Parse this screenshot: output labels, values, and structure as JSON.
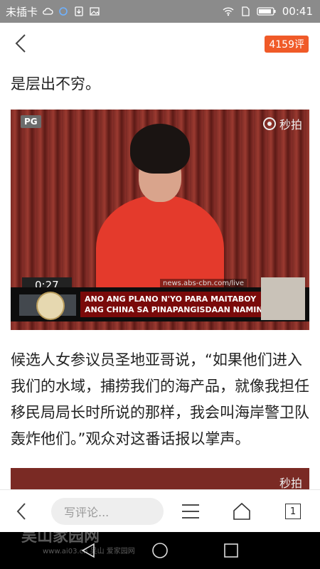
{
  "status_bar": {
    "carrier": "未插卡",
    "time": "00:41",
    "icons": [
      "cloud-icon",
      "sync-icon",
      "download-icon",
      "image-icon",
      "wifi-icon",
      "sim-icon",
      "battery-icon"
    ]
  },
  "header": {
    "comment_count": "4159评"
  },
  "article": {
    "paragraph_tail": "是层出不穷。",
    "video": {
      "rating": "PG",
      "watermark": "秒拍",
      "timestamp": "0:27",
      "source_url": "news.abs-cbn.com/live",
      "caption_line1": "ANO ANG PLANO N'YO PARA MAITABOY",
      "caption_line2": "ANG CHINA SA PINAPANGISDAAN NAMIN?"
    },
    "caption": "候选人女参议员圣地亚哥说，“如果他们进入我们的水域，捕捞我们的海产品，就像我担任移民局局长时所说的那样，我会叫海岸警卫队轰炸他们。”观众对这番话报以掌声。",
    "video2_watermark": "秒拍"
  },
  "bottom_bar": {
    "comment_placeholder": "写评论...",
    "tab_count": "1"
  },
  "nav_bar": {
    "watermark": "吴山家园网",
    "watermark_sub": "www.ai03.cn 吴山 爱家园网"
  },
  "colors": {
    "accent": "#f05a28",
    "status_bar": "#8b8b8b"
  }
}
